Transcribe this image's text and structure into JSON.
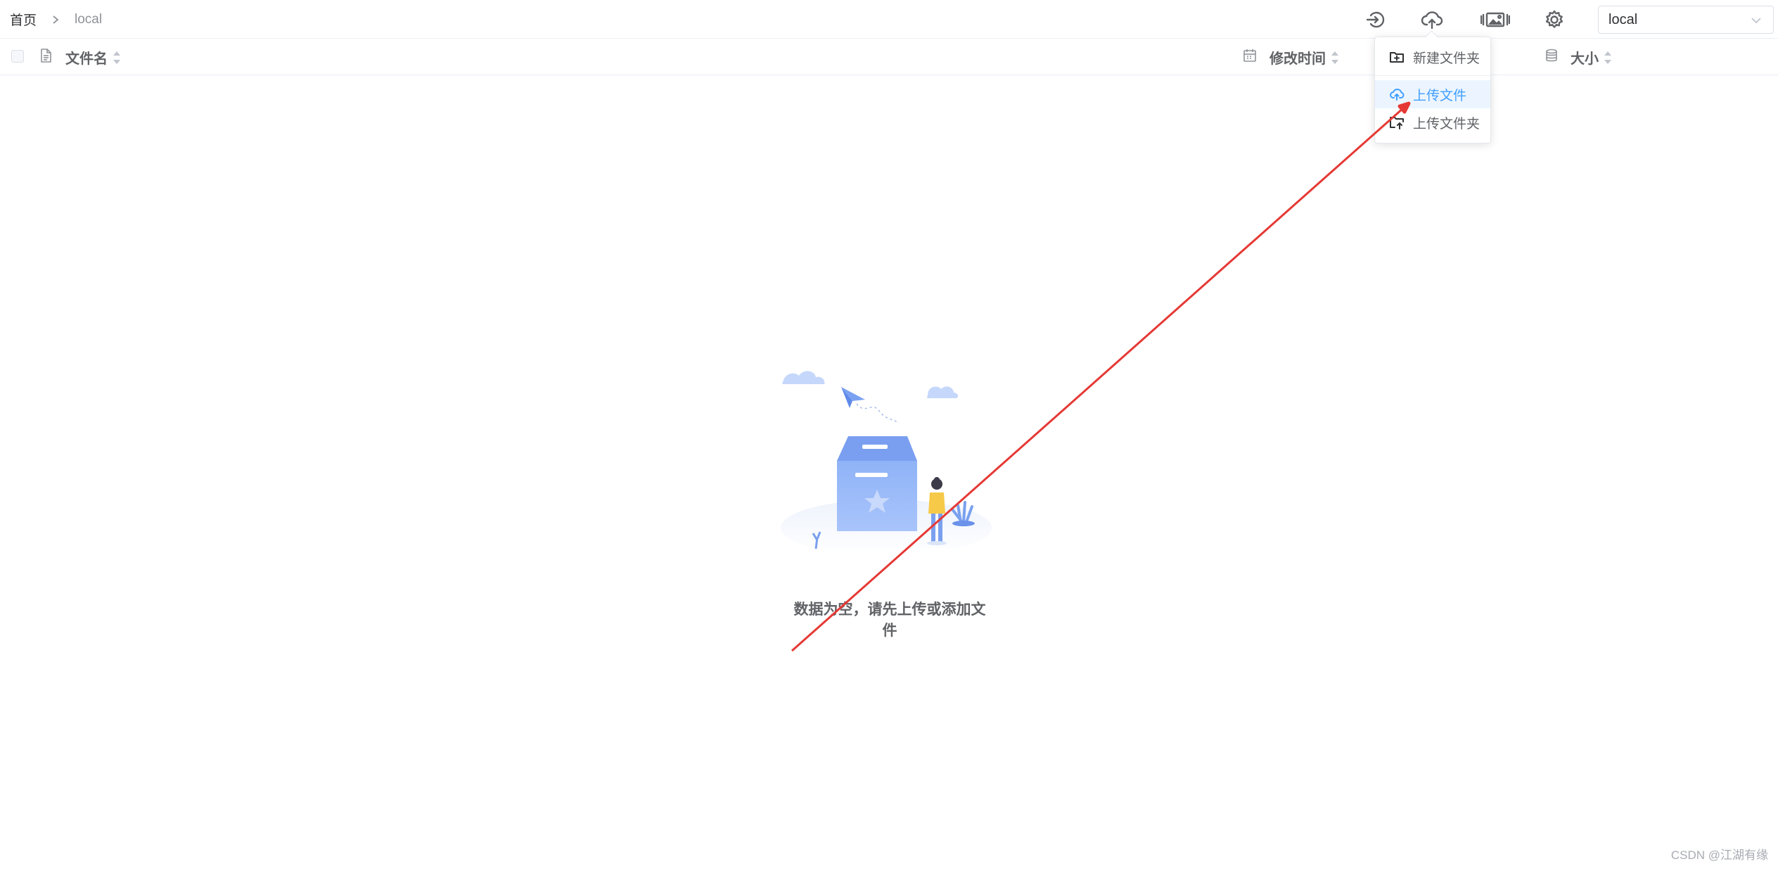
{
  "breadcrumb": {
    "home": "首页",
    "current": "local"
  },
  "toolbar": {
    "icons": [
      "logout-icon",
      "cloud-upload-icon",
      "image-gallery-icon",
      "gear-icon"
    ]
  },
  "storage_select": {
    "value": "local"
  },
  "table": {
    "columns": {
      "name": "文件名",
      "modified": "修改时间",
      "size": "大小"
    }
  },
  "upload_menu": {
    "items": [
      {
        "label": "新建文件夹",
        "icon": "folder-add-icon"
      },
      {
        "label": "上传文件",
        "icon": "cloud-upload-icon",
        "highlighted": true
      },
      {
        "label": "上传文件夹",
        "icon": "folder-upload-icon"
      }
    ]
  },
  "empty_state": {
    "message": "数据为空，请先上传或添加文件"
  },
  "colors": {
    "accent": "#409eff",
    "annotation": "#e53935",
    "text": "#606266",
    "border": "#ebeef5"
  },
  "watermark": "CSDN @江湖有缘"
}
